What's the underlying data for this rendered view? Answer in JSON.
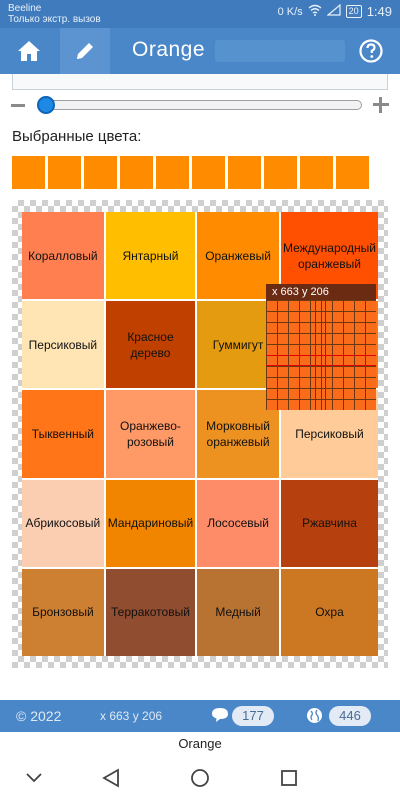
{
  "status_bar": {
    "carrier": "Beeline",
    "carrier_note": "Только экстр. вызов",
    "net_speed": "0 K/s",
    "battery": "20",
    "time": "1:49"
  },
  "app_bar": {
    "title": "Orange",
    "icons": [
      "home-icon",
      "pencil-icon",
      "help-icon"
    ]
  },
  "selected_colors": {
    "label": "Выбранные цвета:",
    "swatches": [
      "#ff8c00",
      "#ff8c00",
      "#ff8c00",
      "#ff8c00",
      "#ff8c00",
      "#ff8c00",
      "#ff8c00",
      "#ff8c00",
      "#ff8c00",
      "#ff8c00"
    ]
  },
  "colors": [
    {
      "name": "Коралловый",
      "hex": "#ff7f50"
    },
    {
      "name": "Янтарный",
      "hex": "#ffbf00"
    },
    {
      "name": "Оранжевый",
      "hex": "#ff8c00"
    },
    {
      "name": "Международный оранжевый",
      "hex": "#ff4f00"
    },
    {
      "name": "Персиковый",
      "hex": "#ffe5b4"
    },
    {
      "name": "Красное дерево",
      "hex": "#c04000"
    },
    {
      "name": "Гуммигут",
      "hex": "#e49b0f"
    },
    {
      "name": "",
      "hex": "#ff7518"
    },
    {
      "name": "Тыквенный",
      "hex": "#ff7518"
    },
    {
      "name": "Оранжево-розовый",
      "hex": "#ff9966"
    },
    {
      "name": "Морковный оранжевый",
      "hex": "#ed9121"
    },
    {
      "name": "Персиковый",
      "hex": "#ffcc99"
    },
    {
      "name": "Абрикосовый",
      "hex": "#fbceb1"
    },
    {
      "name": "Мандариновый",
      "hex": "#f28500"
    },
    {
      "name": "Лососевый",
      "hex": "#ff8c69"
    },
    {
      "name": "Ржавчина",
      "hex": "#b7410e"
    },
    {
      "name": "Бронзовый",
      "hex": "#cd7f32"
    },
    {
      "name": "Терракотовый",
      "hex": "#904d30"
    },
    {
      "name": "Медный",
      "hex": "#b87333"
    },
    {
      "name": "Охра",
      "hex": "#cc7722"
    }
  ],
  "magnifier": {
    "coords": "x 663 y 206"
  },
  "footer": {
    "copyright": "© 2022",
    "coords": "x 663 y 206",
    "comments_count": "177",
    "views_count": "446"
  },
  "bottom_title": "Orange"
}
